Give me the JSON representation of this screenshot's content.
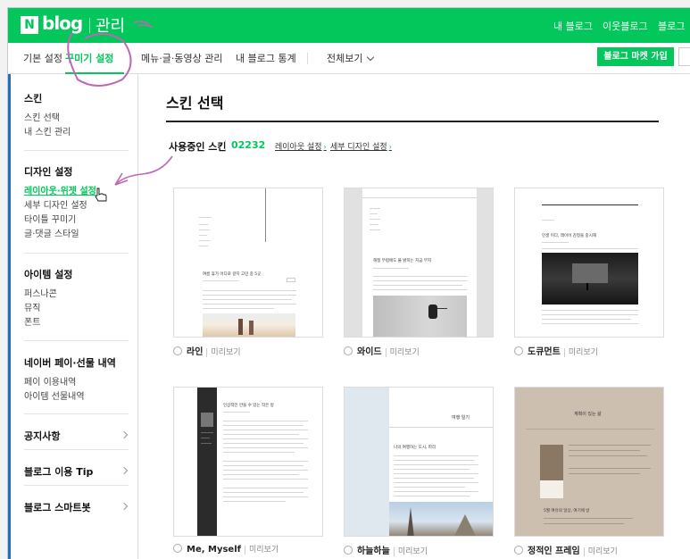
{
  "header": {
    "logo_n": "N",
    "logo_blog": "blog",
    "admin": "관리",
    "links": [
      "내 블로그",
      "이웃블로그",
      "블로그"
    ]
  },
  "subnav": {
    "tabs": [
      "기본 설정",
      "꾸미기 설정",
      "메뉴·글·동영상 관리",
      "내 블로그 통계",
      "전체보기"
    ],
    "active": "꾸미기 설정",
    "market_button": "블로그 마켓 가입"
  },
  "sidebar": {
    "sections": [
      {
        "title": "스킨",
        "items": [
          "스킨 선택",
          "내 스킨 관리"
        ]
      },
      {
        "title": "디자인 설정",
        "items": [
          "레이아웃·위젯 설정",
          "세부 디자인 설정",
          "타이틀 꾸미기",
          "글·댓글 스타일"
        ],
        "active": "레이아웃·위젯 설정"
      },
      {
        "title": "아이템 설정",
        "items": [
          "퍼스나콘",
          "뮤직",
          "폰트"
        ]
      },
      {
        "title": "네이버 페이·선물 내역",
        "items": [
          "페이 이용내역",
          "아이템 선물내역"
        ]
      }
    ],
    "links": [
      "공지사항",
      "블로그 이용 Tip",
      "블로그 스마트봇"
    ]
  },
  "main": {
    "title": "스킨 선택",
    "current_label": "사용중인 스킨",
    "current_code": "02232",
    "layout_link": "레이아웃 설정",
    "detail_link": "세부 디자인 설정",
    "preview_label": "미리보기",
    "skins": [
      "라인",
      "와이드",
      "도큐먼트",
      "Me, Myself",
      "하늘하늘",
      "정적인 프레임"
    ],
    "thumb_text": {
      "line_title": "여름 휴가 어디로 갈지 고민 중 5곳",
      "wide_title": "해질 무렵에도 불 밝히는 지금 부지",
      "doc_title": "인생 이다, 레이어 감정을 중시해",
      "me_title": "인상적인 만들 수 있는 작은 방",
      "sky_title": "나의 여행하는 도시, 파리",
      "sky_header": "여행 일기",
      "frame_header": "계획이 있는 삶",
      "frame_title": "5월 여유의 일상, 여기에 방"
    }
  },
  "colors": {
    "brand_green": "#03c75a",
    "sidebar_accent": "#1f6fbf",
    "annotation_pink": "#c066b6"
  }
}
